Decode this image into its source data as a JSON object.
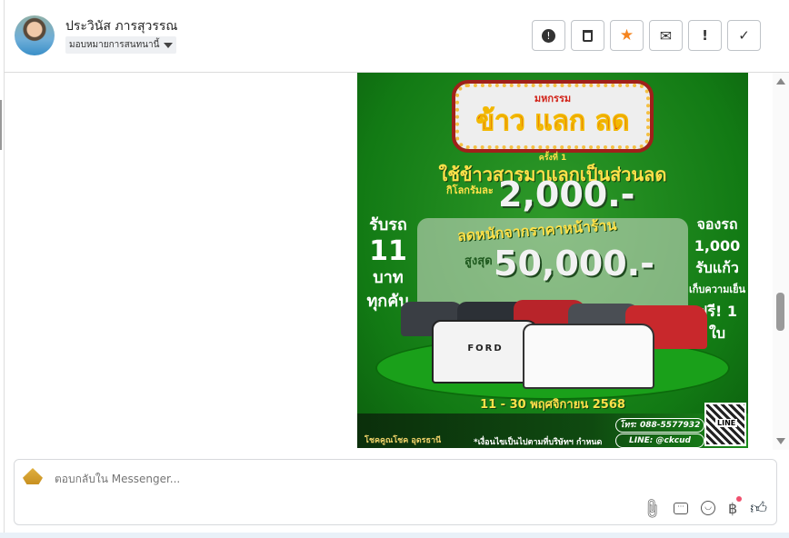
{
  "header": {
    "contact_name": "ประวินัส ภารสุวรรณ",
    "assign_label": "มอบหมายการสนทนานี้",
    "actions": [
      {
        "name": "spam",
        "glyph": "❗"
      },
      {
        "name": "delete",
        "glyph": "🗑"
      },
      {
        "name": "star",
        "glyph": "★"
      },
      {
        "name": "mark-unread",
        "glyph": "✉"
      },
      {
        "name": "important",
        "glyph": "!"
      },
      {
        "name": "done",
        "glyph": "✓"
      }
    ],
    "star_color": "#f5841f"
  },
  "poster": {
    "event_small": "มหกรรม",
    "event_title": "ข้าว แลก ลด",
    "round": "ครั้งที่ 1",
    "headline": "ใช้ข้าวสารมาแลกเป็นส่วนลด",
    "per_kg": "กิโลกรัมละ",
    "price_per_kg": "2,000.-",
    "discount_line": "ลดหนักจากราคาหน้าร้าน",
    "max_label": "สูงสุด",
    "max_discount": "50,000.-",
    "left_offer": [
      "รับรถ",
      "11",
      "บาท",
      "ทุกคัน"
    ],
    "right_offer": [
      "จองรถ",
      "1,000",
      "รับแก้ว",
      "เก็บความเย็น",
      "ฟรี! 1 ใบ"
    ],
    "dates": "11 - 30 พฤศจิกายน 2568",
    "car_badge": "FORD",
    "shop_name": "โชคคูณโชค อุดรธานี",
    "conditions": "*เงื่อนไขเป็นไปตามที่บริษัทฯ กำหนด",
    "phone": "โทร: 088-5577932",
    "line": "LINE: @ckcud",
    "qr_label": "LINE",
    "brand_green": "#127a14",
    "accent_yellow": "#ffe14a"
  },
  "composer": {
    "placeholder": "ตอบกลับใน Messenger...",
    "tools": [
      "attach-icon",
      "saved-reply-icon",
      "emoji-icon",
      "payment-icon",
      "like-icon"
    ]
  }
}
